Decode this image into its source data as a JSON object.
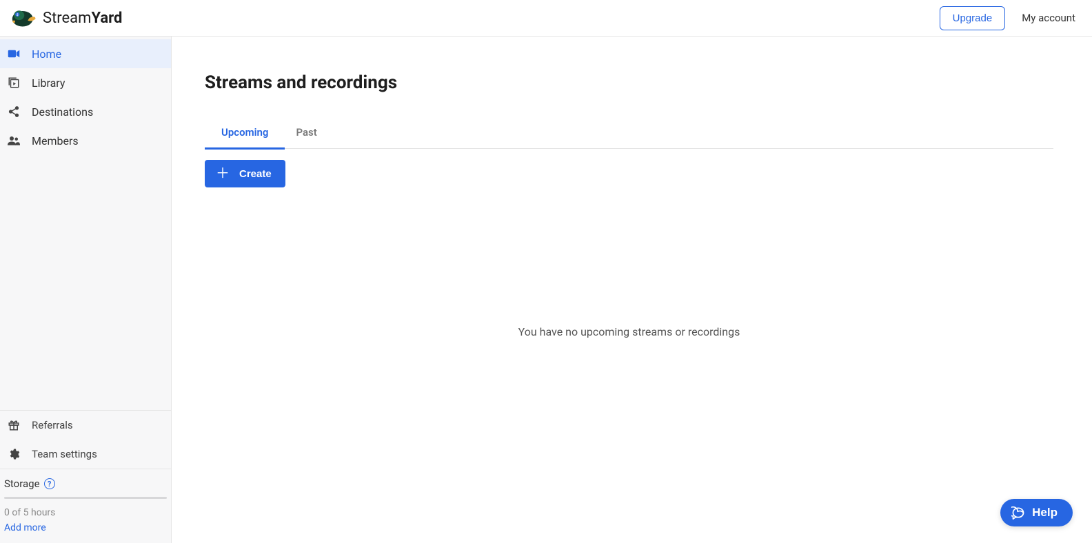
{
  "header": {
    "brand_part1": "Stream",
    "brand_part2": "Yard",
    "upgrade_label": "Upgrade",
    "account_label": "My account"
  },
  "sidebar": {
    "items": [
      {
        "label": "Home"
      },
      {
        "label": "Library"
      },
      {
        "label": "Destinations"
      },
      {
        "label": "Members"
      }
    ],
    "bottom_items": [
      {
        "label": "Referrals"
      },
      {
        "label": "Team settings"
      }
    ],
    "storage": {
      "label": "Storage",
      "usage_text": "0 of 5 hours",
      "add_more_label": "Add more"
    }
  },
  "main": {
    "title": "Streams and recordings",
    "tabs": [
      {
        "label": "Upcoming"
      },
      {
        "label": "Past"
      }
    ],
    "create_label": "Create",
    "empty_message": "You have no upcoming streams or recordings"
  },
  "help": {
    "label": "Help"
  }
}
